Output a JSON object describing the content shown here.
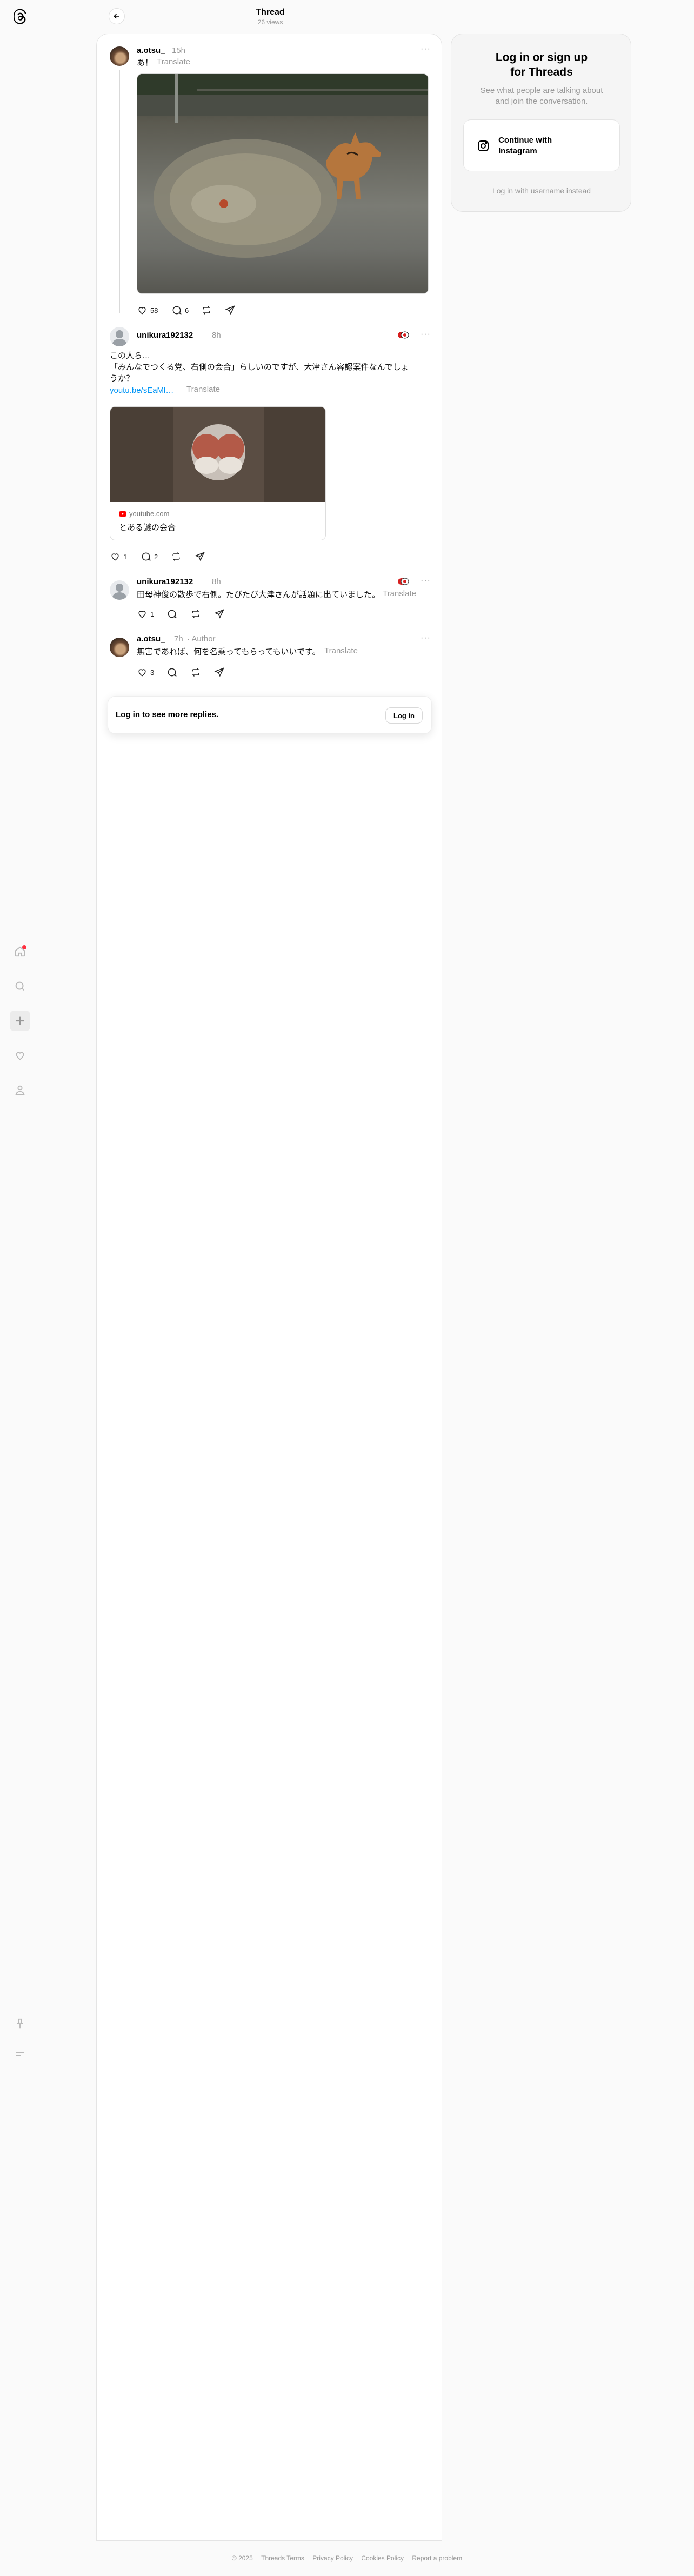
{
  "header": {
    "title": "Thread",
    "views": "26 views"
  },
  "nav": {
    "icons": [
      "threads-logo-icon",
      "home-icon",
      "search-icon",
      "create-icon",
      "heart-icon",
      "profile-icon",
      "pin-icon",
      "menu-icon"
    ]
  },
  "posts": [
    {
      "username": "a.otsu_",
      "time": "15h",
      "text": "あ！",
      "translate": "Translate",
      "likes": "58",
      "replies": "6"
    },
    {
      "username": "unikura192132",
      "time": "8h",
      "text_lines": [
        "この人ら…",
        "「みんなでつくる党、右側の会合」らしいのですが、大津さん容認案件なんでしょ",
        "うか？"
      ],
      "link_text": "youtu.be/sEaMl…",
      "translate": "Translate",
      "card": {
        "domain": "youtube.com",
        "title": "とある謎の会合"
      },
      "likes": "1",
      "replies": "2"
    },
    {
      "username": "unikura192132",
      "time": "8h",
      "text": "田母神俊の散歩で右側。たびたび大津さんが話題に出ていました。",
      "translate": "Translate",
      "likes": "1"
    },
    {
      "username": "a.otsu_",
      "time": "7h",
      "author_badge": "· Author",
      "text": "無害であれば、何を名乗ってもらってもいいです。",
      "translate": "Translate",
      "likes": "3"
    }
  ],
  "login_bar": {
    "text": "Log in to see more replies.",
    "button": "Log in"
  },
  "side": {
    "title_l1": "Log in or sign up",
    "title_l2": "for Threads",
    "desc_l1": "See what people are talking about",
    "desc_l2": "and join the conversation.",
    "ig_button_l1": "Continue with",
    "ig_button_l2": "Instagram",
    "alt_login": "Log in with username instead"
  },
  "footer": [
    "© 2025",
    "Threads Terms",
    "Privacy Policy",
    "Cookies Policy",
    "Report a problem"
  ],
  "colors": {
    "accent_link": "#0095f6",
    "notification_dot": "#ff3040"
  }
}
